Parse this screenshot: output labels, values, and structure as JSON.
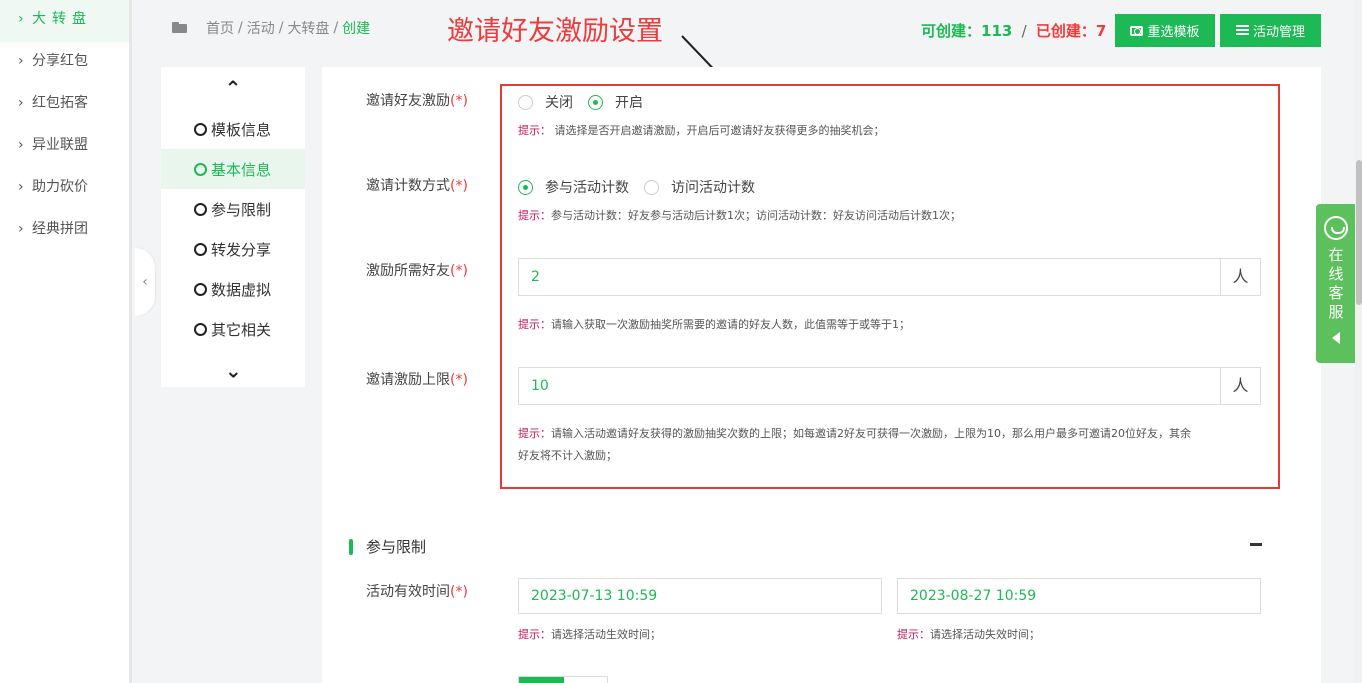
{
  "sidebar": {
    "items": [
      {
        "label": "大转盘",
        "active": true
      },
      {
        "label": "分享红包"
      },
      {
        "label": "红包拓客"
      },
      {
        "label": "异业联盟"
      },
      {
        "label": "助力砍价"
      },
      {
        "label": "经典拼团"
      }
    ]
  },
  "breadcrumb": {
    "home": "首页",
    "level1": "活动",
    "level2": "大转盘",
    "current": "创建",
    "sep": "/"
  },
  "annotation": {
    "title": "邀请好友激励设置"
  },
  "counts": {
    "creatable_label": "可创建：",
    "creatable_value": "113",
    "slash": "/",
    "created_label": "已创建：",
    "created_value": "7"
  },
  "toolbar": {
    "reselect_label": "重选模板",
    "manage_label": "活动管理"
  },
  "stepnav": {
    "items": [
      {
        "label": "模板信息"
      },
      {
        "label": "基本信息",
        "active": true
      },
      {
        "label": "参与限制"
      },
      {
        "label": "转发分享"
      },
      {
        "label": "数据虚拟"
      },
      {
        "label": "其它相关"
      }
    ]
  },
  "form": {
    "req_mark": "(*)",
    "tip_key": "提示：",
    "invite_incentive": {
      "label": "邀请好友激励",
      "options": [
        "关闭",
        "开启"
      ],
      "selected": "开启",
      "tip": "请选择是否开启邀请激励，开启后可邀请好友获得更多的抽奖机会；"
    },
    "count_mode": {
      "label": "邀请计数方式",
      "options": [
        "参与活动计数",
        "访问活动计数"
      ],
      "selected": "参与活动计数",
      "tip": "参与活动计数：好友参与活动后计数1次；访问活动计数：好友访问活动后计数1次；"
    },
    "friends_needed": {
      "label": "激励所需好友",
      "value": "2",
      "unit": "人",
      "tip": "请输入获取一次激励抽奖所需要的邀请的好友人数，此值需等于或等于1；"
    },
    "incentive_limit": {
      "label": "邀请激励上限",
      "value": "10",
      "unit": "人",
      "tip_line1": "请输入活动邀请好友获得的激励抽奖次数的上限；如每邀请2好友可获得一次激励，上限为10，那么用户最多可邀请20位好友，其余",
      "tip_line2": "好友将不计入激励；"
    },
    "section_participation": {
      "title": "参与限制"
    },
    "valid_time": {
      "label": "活动有效时间",
      "start": "2023-07-13 10:59",
      "end": "2023-08-27 10:59",
      "tip_start": "请选择活动生效时间；",
      "tip_end": "请选择活动失效时间；"
    }
  },
  "service": {
    "chars": [
      "在",
      "线",
      "客",
      "服"
    ]
  },
  "colors": {
    "accent": "#1db954",
    "danger": "#ef3b3b",
    "tip_key": "#c2185b",
    "service_bg": "#5cc15c"
  }
}
